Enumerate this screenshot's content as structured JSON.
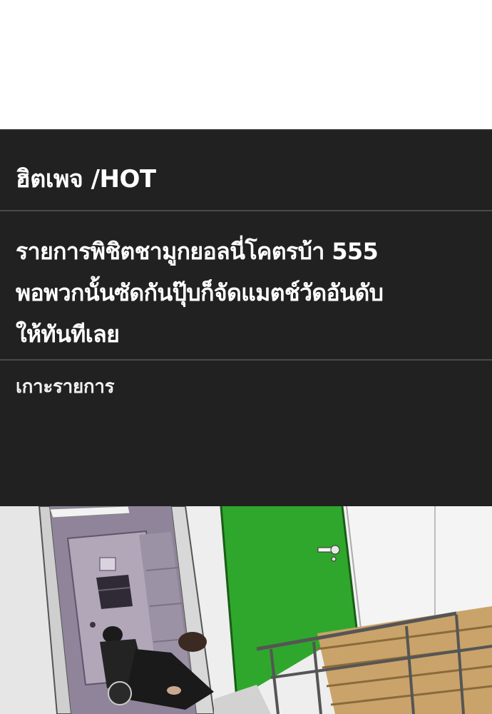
{
  "section": {
    "label": "ฮิตเพจ /HOT"
  },
  "article": {
    "headline_lines": [
      "รายการพิชิตชามูกยอลนี่โคตรบ้า 555",
      "พอพวกนั้นซัดกันปุ๊บก็จัดแมตช์วัดอันดับ",
      "ให้ทันทีเลย"
    ],
    "category": "เกาะรายการ"
  },
  "colors": {
    "panel_background": "#212121",
    "divider": "#4a4a4a",
    "text": "#ffffff",
    "door_green": "#2fa72c"
  },
  "illustration": {
    "subject": "comic-panel-gym-interior"
  }
}
